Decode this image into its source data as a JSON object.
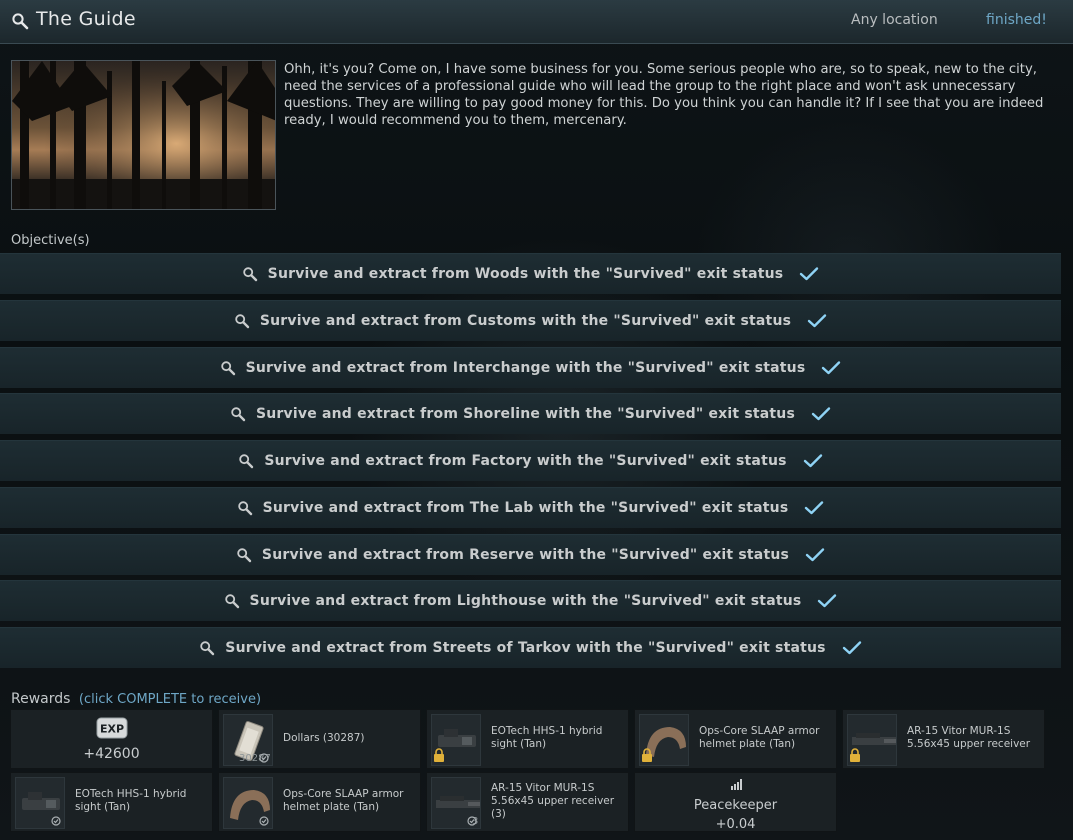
{
  "header": {
    "title": "The Guide",
    "location": "Any location",
    "status": "finished!",
    "icon": "search-icon"
  },
  "description": "Ohh, it's you? Come on, I have some business for you. Some serious people who are, so to speak, new to the city, need the services of a professional guide who will lead the group to the right place and won't ask unnecessary questions. They are willing to pay good money for this. Do you think you can handle it? If I see that you are indeed ready, I would recommend you to them, mercenary.",
  "objectives_label": "Objective(s)",
  "objectives": [
    "Survive and extract from Woods with the \"Survived\" exit status",
    "Survive and extract from Customs with the \"Survived\" exit status",
    "Survive and extract from Interchange with the \"Survived\" exit status",
    "Survive and extract from Shoreline with the \"Survived\" exit status",
    "Survive and extract from Factory with the \"Survived\" exit status",
    "Survive and extract from The Lab with the \"Survived\" exit status",
    "Survive and extract from Reserve with the \"Survived\" exit status",
    "Survive and extract from Lighthouse with the \"Survived\" exit status",
    "Survive and extract from Streets of Tarkov with the \"Survived\" exit status"
  ],
  "rewards": {
    "label": "Rewards",
    "hint": "(click COMPLETE to receive)",
    "exp_badge": "EXP",
    "exp_value": "+42600",
    "dollars_name": "Dollars (30287)",
    "dollars_qty": "30287",
    "item1": "EOTech HHS-1 hybrid sight (Tan)",
    "item2": "Ops-Core SLAAP armor helmet plate (Tan)",
    "item3": "AR-15 Vitor MUR-1S 5.56x45 upper receiver",
    "item4": "EOTech HHS-1 hybrid sight (Tan)",
    "item5": "Ops-Core SLAAP armor helmet plate (Tan)",
    "item6": "AR-15 Vitor MUR-1S 5.56x45 upper receiver (3)",
    "item6_qty": "3",
    "rep_label": "Peacekeeper",
    "rep_value": "+0.04"
  },
  "colors": {
    "accent": "#6ea7c6",
    "check": "#8fd3f5"
  }
}
